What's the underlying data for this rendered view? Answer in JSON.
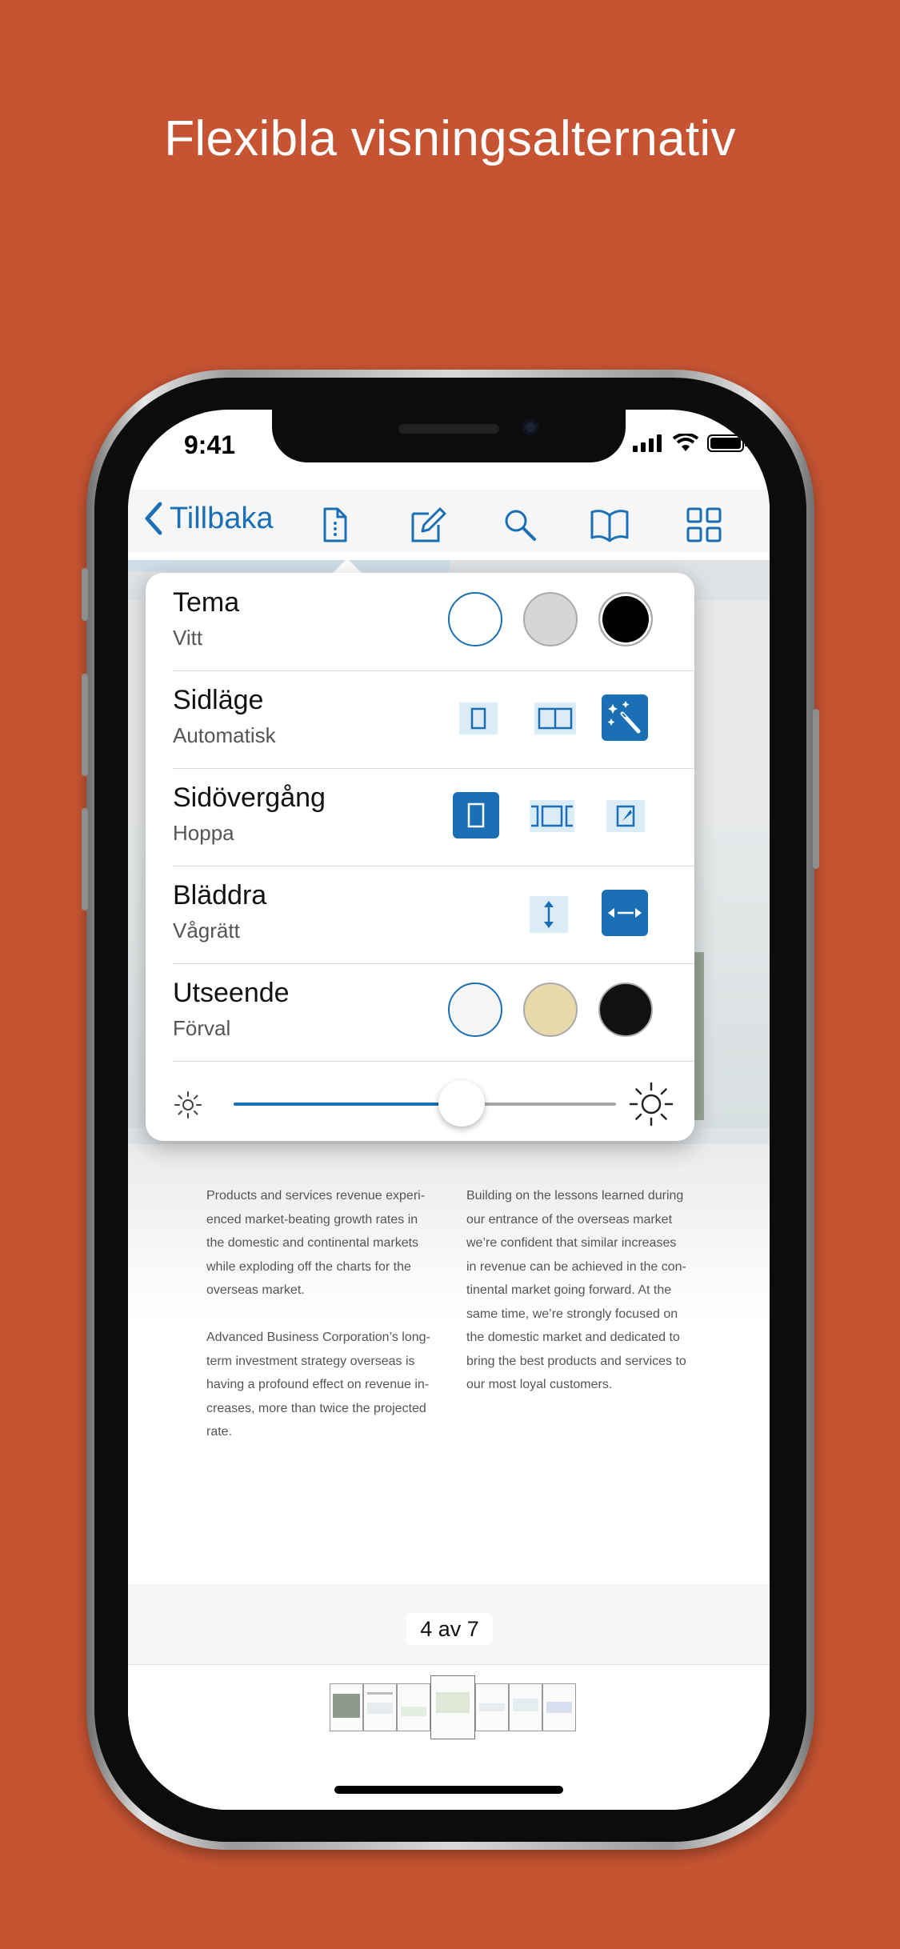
{
  "headline": "Flexibla visningsalternativ",
  "status": {
    "time": "9:41"
  },
  "toolbar": {
    "back_label": "Tillbaka",
    "icons": [
      "document-icon",
      "edit-icon",
      "search-icon",
      "book-icon",
      "grid-icon"
    ]
  },
  "popover": {
    "rows": [
      {
        "title": "Tema",
        "value": "Vitt",
        "options": [
          "white",
          "gray",
          "black"
        ],
        "selected": "white"
      },
      {
        "title": "Sidläge",
        "value": "Automatisk",
        "options": [
          "single-page",
          "two-page",
          "automatic"
        ],
        "selected": "automatic"
      },
      {
        "title": "Sidövergång",
        "value": "Hoppa",
        "options": [
          "jump",
          "slide",
          "page-curl"
        ],
        "selected": "jump"
      },
      {
        "title": "Bläddra",
        "value": "Vågrätt",
        "options": [
          "vertical",
          "horizontal"
        ],
        "selected": "horizontal"
      },
      {
        "title": "Utseende",
        "value": "Förval",
        "options": [
          "default",
          "sepia",
          "night"
        ],
        "selected": "default"
      }
    ],
    "brightness_level": 0.57
  },
  "document": {
    "col_left": [
      "Products and services revenue experi-",
      "enced market-beating growth rates in",
      "the domestic and continental markets",
      "while exploding off the charts for the",
      "overseas market.",
      "",
      "Advanced Business Corporation’s long-",
      "term investment strategy overseas is",
      "having a profound effect on revenue in-",
      "creases, more than twice the projected",
      "rate."
    ],
    "col_right": [
      "Building on the lessons learned during",
      "our entrance of the overseas market",
      "we’re confident that similar increases",
      "in revenue can be achieved in the con-",
      "tinental market going forward. At the",
      "same time, we’re strongly focused on",
      "the domestic market and dedicated to",
      "bring the best products and services to",
      "our most loyal customers."
    ]
  },
  "page_indicator": "4 av 7",
  "colors": {
    "background": "#c65432",
    "accent": "#1a6fb5"
  }
}
